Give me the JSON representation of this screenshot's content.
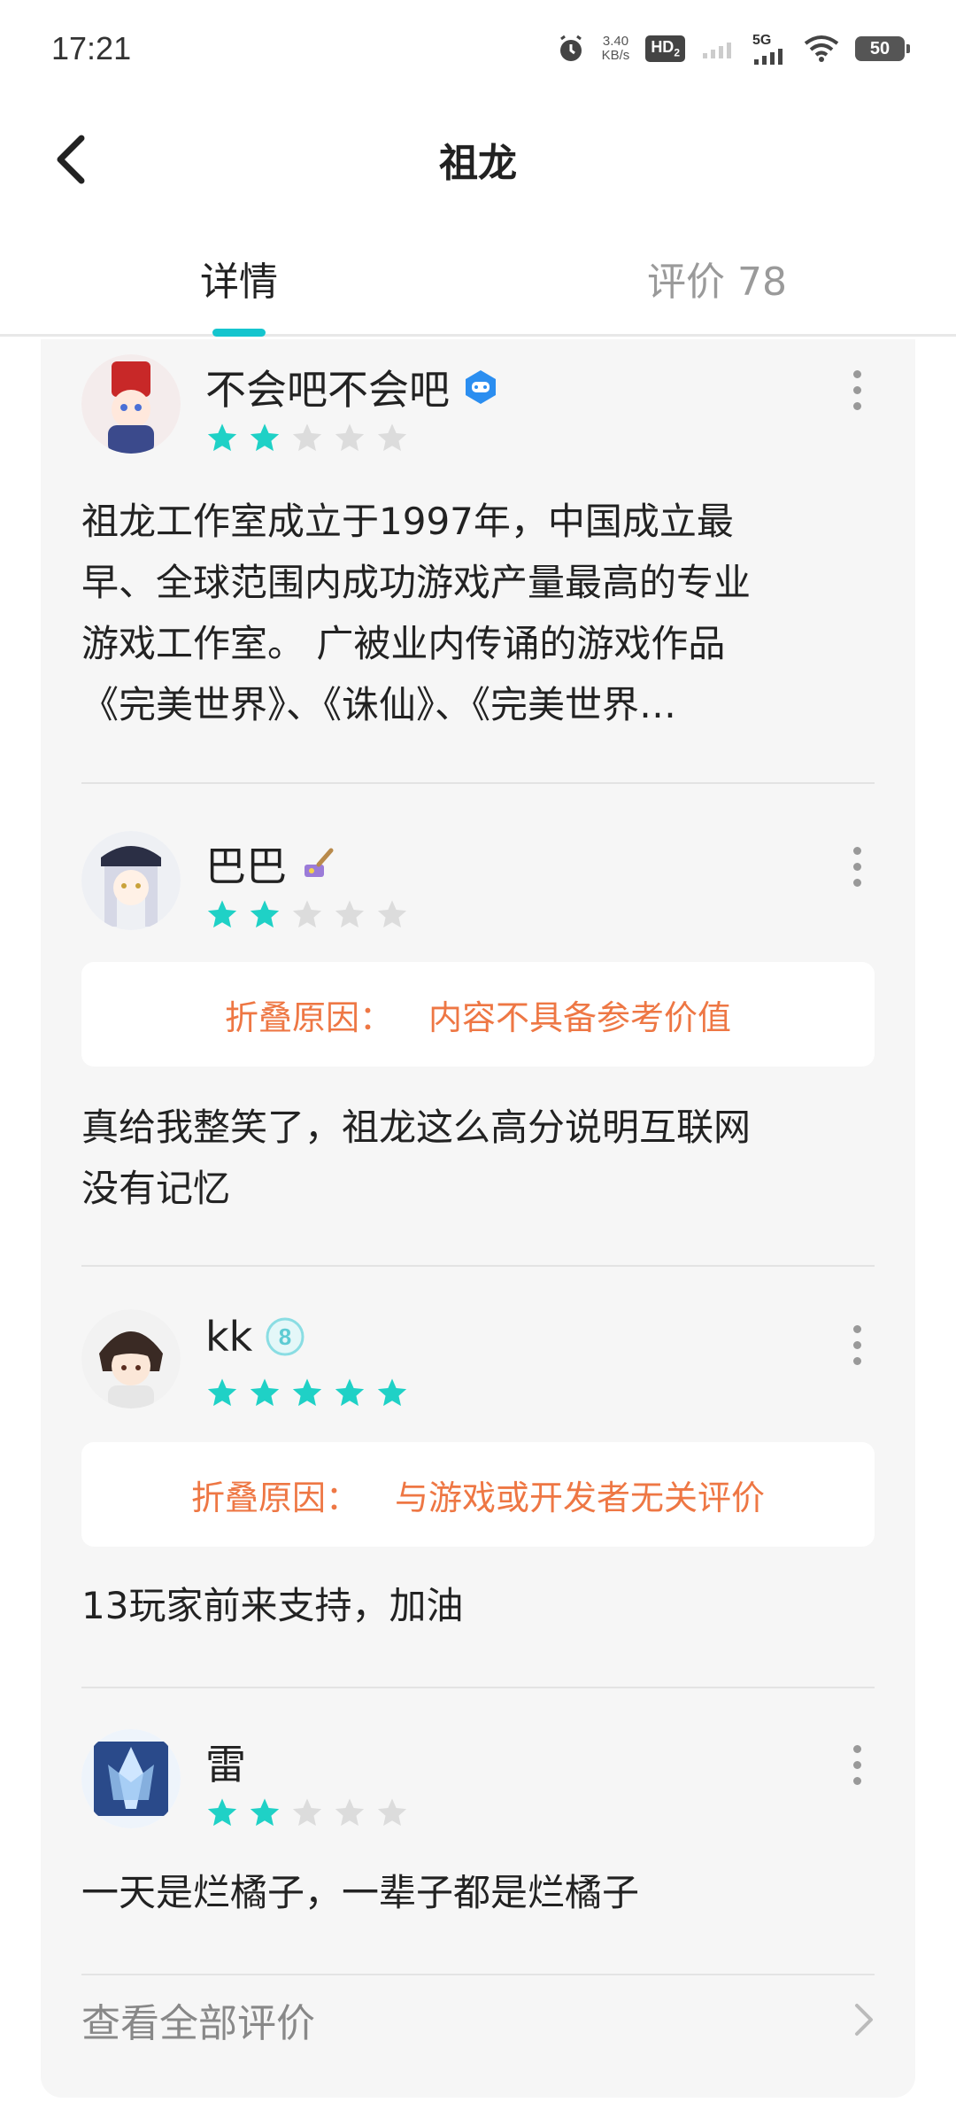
{
  "status_bar": {
    "time": "17:21",
    "speed_value": "3.40",
    "speed_unit": "KB/s",
    "hd_label": "HD",
    "hd_sub": "2",
    "network": "5G",
    "battery": "50"
  },
  "header": {
    "title": "祖龙"
  },
  "tabs": [
    {
      "label": "详情",
      "active": true
    },
    {
      "label": "评价 78",
      "active": false
    }
  ],
  "reviews": [
    {
      "username": "不会吧不会吧",
      "badge_icon": "game-controller-badge-icon",
      "rating": 2,
      "text_lines": [
        "祖龙工作室成立于1997年，中国成立最",
        "早、全球范围内成功游戏产量最高的专业",
        "游戏工作室。 广被业内传诵的游戏作品",
        "《完美世界》、《诛仙》、《完美世界…"
      ]
    },
    {
      "username": "巴巴",
      "badge_icon": "brush-badge-icon",
      "rating": 2,
      "fold_label": "折叠原因：",
      "fold_reason": "内容不具备参考价值",
      "text_lines": [
        "真给我整笑了，祖龙这么高分说明互联网",
        "没有记忆"
      ]
    },
    {
      "username": "kk",
      "badge_icon": "level-8-badge-icon",
      "badge_text": "8",
      "rating": 5,
      "fold_label": "折叠原因：",
      "fold_reason": "与游戏或开发者无关评价",
      "text_lines": [
        "13玩家前来支持，加油"
      ]
    },
    {
      "username": "雷",
      "rating": 2,
      "text_lines": [
        "一天是烂橘子，一辈子都是烂橘子"
      ]
    }
  ],
  "view_all": {
    "label": "查看全部评价"
  },
  "colors": {
    "accent": "#15c5ce",
    "star_filled": "#1fd1c6",
    "star_empty": "#dcdcdc",
    "fold_text": "#ee7744"
  }
}
